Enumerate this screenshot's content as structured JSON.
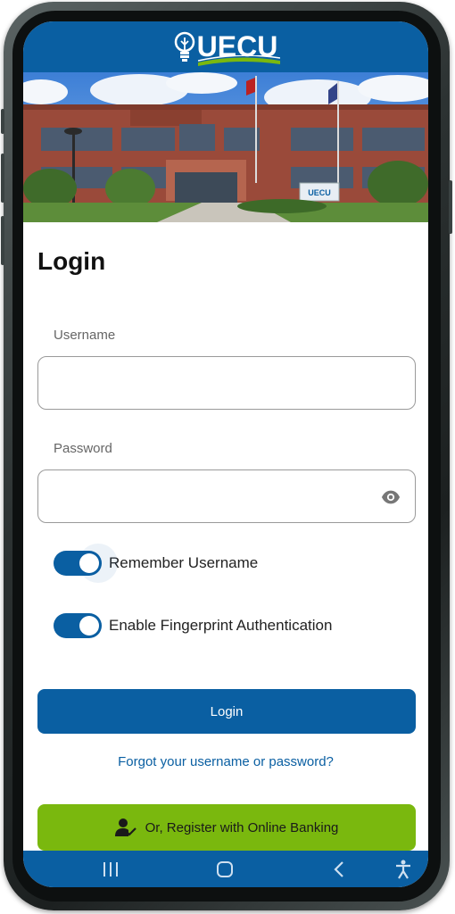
{
  "app": {
    "logo_text": "UECU"
  },
  "login": {
    "title": "Login",
    "username_label": "Username",
    "username_value": "",
    "password_label": "Password",
    "password_value": "",
    "remember_username_label": "Remember Username",
    "remember_username_on": true,
    "fingerprint_label": "Enable Fingerprint Authentication",
    "fingerprint_on": true,
    "login_button": "Login",
    "forgot_link": "Forgot your username or password?",
    "register_button": "Or, Register with Online Banking"
  },
  "hero": {
    "building_sign": "UECU"
  },
  "icons": {
    "password_toggle": "eye-icon",
    "register": "user-check-icon",
    "nav_recents": "recents-icon",
    "nav_home": "home-icon",
    "nav_back": "back-icon",
    "nav_accessibility": "accessibility-icon",
    "logo": "lightbulb-icon"
  },
  "colors": {
    "primary": "#0a5fa2",
    "accent": "#7ab80e",
    "link": "#0a5fa2"
  }
}
